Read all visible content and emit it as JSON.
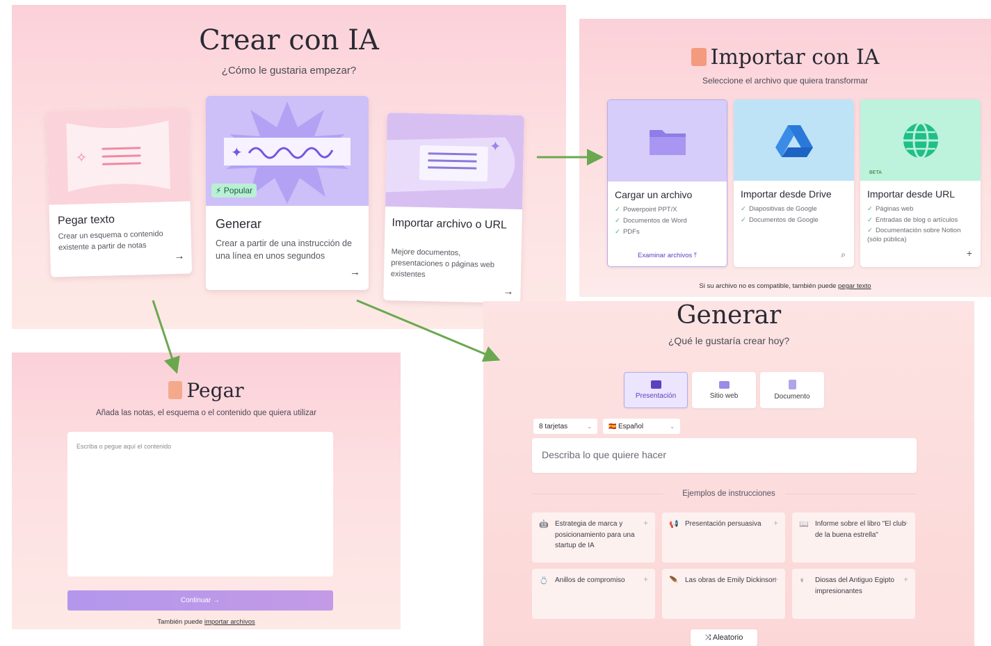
{
  "crear": {
    "title": "Crear con IA",
    "subtitle": "¿Cómo le gustaria empezar?",
    "cards": {
      "paste": {
        "title": "Pegar texto",
        "desc": "Crear un esquema o contenido existente a partir de notas",
        "arrow": "→"
      },
      "generate": {
        "badge": "⚡ Popular",
        "title": "Generar",
        "desc": "Crear a partir de una instrucción de una línea en unos segundos",
        "arrow": "→"
      },
      "import": {
        "title": "Importar archivo o URL",
        "desc": "Mejore documentos, presentaciones o páginas web existentes",
        "arrow": "→"
      }
    }
  },
  "importar": {
    "title": "Importar con IA",
    "subtitle": "Seleccione el archivo que quiera transformar",
    "cards": {
      "upload": {
        "title": "Cargar un archivo",
        "items": [
          "Powerpoint PPT/X",
          "Documentos de Word",
          "PDFs"
        ],
        "action": "Examinar archivos ⤒"
      },
      "drive": {
        "title": "Importar desde Drive",
        "items": [
          "Diapositivas de Google",
          "Documentos de Google"
        ]
      },
      "url": {
        "badge": "BETA",
        "title": "Importar desde URL",
        "items": [
          "Páginas web",
          "Entradas de blog o artículos",
          "Documentación sobre Notion (sólo pública)"
        ]
      }
    },
    "footnote_prefix": "Si su archivo no es compatible, también puede ",
    "footnote_link": "pegar texto"
  },
  "pegar": {
    "title": "Pegar",
    "subtitle": "Añada las notas, el esquema o el contenido que quiera utilizar",
    "placeholder": "Escriba o pegue aquí el contenido",
    "continue": "Continuar →",
    "footnote_prefix": "También puede ",
    "footnote_link": "importar archivos"
  },
  "generar": {
    "title": "Generar",
    "subtitle": "¿Qué le gustaría crear hoy?",
    "types": [
      {
        "label": "Presentación",
        "icon": "presentation-icon"
      },
      {
        "label": "Sitio web",
        "icon": "monitor-icon"
      },
      {
        "label": "Documento",
        "icon": "document-icon"
      }
    ],
    "cards_select": "8 tarjetas",
    "lang_flag": "🇪🇸",
    "lang_select": "Español",
    "prompt_placeholder": "Describa lo que quiere hacer",
    "examples_label": "Ejemplos de instrucciones",
    "examples": [
      {
        "text": "Estrategia de marca y posicionamiento para una startup de IA",
        "icon": "🤖"
      },
      {
        "text": "Presentación persuasiva",
        "icon": "📢"
      },
      {
        "text": "Informe sobre el libro \"El club de la buena estrella\"",
        "icon": "📖"
      },
      {
        "text": "Anillos de compromiso",
        "icon": "💍"
      },
      {
        "text": "Las obras de Emily Dickinson",
        "icon": "🪶"
      },
      {
        "text": "Diosas del Antiguo Egipto impresionantes",
        "icon": "♀"
      }
    ],
    "random": "⤨ Aleatorio"
  },
  "colors": {
    "arrow": "#6aa84f",
    "accent": "#b6a7ee"
  }
}
